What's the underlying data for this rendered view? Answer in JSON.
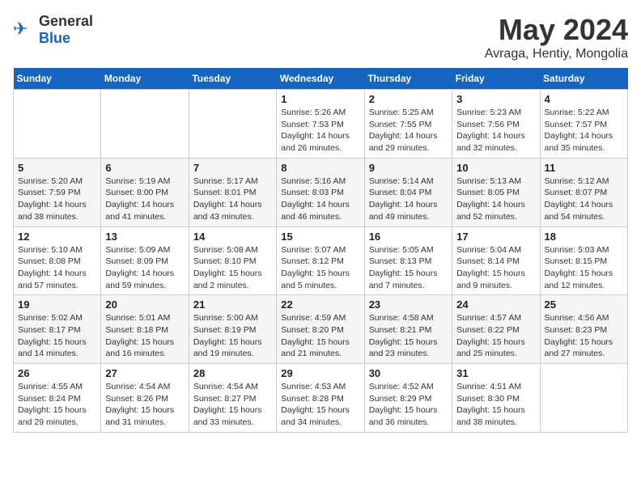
{
  "logo": {
    "general": "General",
    "blue": "Blue"
  },
  "title": "May 2024",
  "location": "Avraga, Hentiy, Mongolia",
  "days_of_week": [
    "Sunday",
    "Monday",
    "Tuesday",
    "Wednesday",
    "Thursday",
    "Friday",
    "Saturday"
  ],
  "weeks": [
    [
      {
        "day": "",
        "sunrise": "",
        "sunset": "",
        "daylight": ""
      },
      {
        "day": "",
        "sunrise": "",
        "sunset": "",
        "daylight": ""
      },
      {
        "day": "",
        "sunrise": "",
        "sunset": "",
        "daylight": ""
      },
      {
        "day": "1",
        "sunrise": "Sunrise: 5:26 AM",
        "sunset": "Sunset: 7:53 PM",
        "daylight": "Daylight: 14 hours and 26 minutes."
      },
      {
        "day": "2",
        "sunrise": "Sunrise: 5:25 AM",
        "sunset": "Sunset: 7:55 PM",
        "daylight": "Daylight: 14 hours and 29 minutes."
      },
      {
        "day": "3",
        "sunrise": "Sunrise: 5:23 AM",
        "sunset": "Sunset: 7:56 PM",
        "daylight": "Daylight: 14 hours and 32 minutes."
      },
      {
        "day": "4",
        "sunrise": "Sunrise: 5:22 AM",
        "sunset": "Sunset: 7:57 PM",
        "daylight": "Daylight: 14 hours and 35 minutes."
      }
    ],
    [
      {
        "day": "5",
        "sunrise": "Sunrise: 5:20 AM",
        "sunset": "Sunset: 7:59 PM",
        "daylight": "Daylight: 14 hours and 38 minutes."
      },
      {
        "day": "6",
        "sunrise": "Sunrise: 5:19 AM",
        "sunset": "Sunset: 8:00 PM",
        "daylight": "Daylight: 14 hours and 41 minutes."
      },
      {
        "day": "7",
        "sunrise": "Sunrise: 5:17 AM",
        "sunset": "Sunset: 8:01 PM",
        "daylight": "Daylight: 14 hours and 43 minutes."
      },
      {
        "day": "8",
        "sunrise": "Sunrise: 5:16 AM",
        "sunset": "Sunset: 8:03 PM",
        "daylight": "Daylight: 14 hours and 46 minutes."
      },
      {
        "day": "9",
        "sunrise": "Sunrise: 5:14 AM",
        "sunset": "Sunset: 8:04 PM",
        "daylight": "Daylight: 14 hours and 49 minutes."
      },
      {
        "day": "10",
        "sunrise": "Sunrise: 5:13 AM",
        "sunset": "Sunset: 8:05 PM",
        "daylight": "Daylight: 14 hours and 52 minutes."
      },
      {
        "day": "11",
        "sunrise": "Sunrise: 5:12 AM",
        "sunset": "Sunset: 8:07 PM",
        "daylight": "Daylight: 14 hours and 54 minutes."
      }
    ],
    [
      {
        "day": "12",
        "sunrise": "Sunrise: 5:10 AM",
        "sunset": "Sunset: 8:08 PM",
        "daylight": "Daylight: 14 hours and 57 minutes."
      },
      {
        "day": "13",
        "sunrise": "Sunrise: 5:09 AM",
        "sunset": "Sunset: 8:09 PM",
        "daylight": "Daylight: 14 hours and 59 minutes."
      },
      {
        "day": "14",
        "sunrise": "Sunrise: 5:08 AM",
        "sunset": "Sunset: 8:10 PM",
        "daylight": "Daylight: 15 hours and 2 minutes."
      },
      {
        "day": "15",
        "sunrise": "Sunrise: 5:07 AM",
        "sunset": "Sunset: 8:12 PM",
        "daylight": "Daylight: 15 hours and 5 minutes."
      },
      {
        "day": "16",
        "sunrise": "Sunrise: 5:05 AM",
        "sunset": "Sunset: 8:13 PM",
        "daylight": "Daylight: 15 hours and 7 minutes."
      },
      {
        "day": "17",
        "sunrise": "Sunrise: 5:04 AM",
        "sunset": "Sunset: 8:14 PM",
        "daylight": "Daylight: 15 hours and 9 minutes."
      },
      {
        "day": "18",
        "sunrise": "Sunrise: 5:03 AM",
        "sunset": "Sunset: 8:15 PM",
        "daylight": "Daylight: 15 hours and 12 minutes."
      }
    ],
    [
      {
        "day": "19",
        "sunrise": "Sunrise: 5:02 AM",
        "sunset": "Sunset: 8:17 PM",
        "daylight": "Daylight: 15 hours and 14 minutes."
      },
      {
        "day": "20",
        "sunrise": "Sunrise: 5:01 AM",
        "sunset": "Sunset: 8:18 PM",
        "daylight": "Daylight: 15 hours and 16 minutes."
      },
      {
        "day": "21",
        "sunrise": "Sunrise: 5:00 AM",
        "sunset": "Sunset: 8:19 PM",
        "daylight": "Daylight: 15 hours and 19 minutes."
      },
      {
        "day": "22",
        "sunrise": "Sunrise: 4:59 AM",
        "sunset": "Sunset: 8:20 PM",
        "daylight": "Daylight: 15 hours and 21 minutes."
      },
      {
        "day": "23",
        "sunrise": "Sunrise: 4:58 AM",
        "sunset": "Sunset: 8:21 PM",
        "daylight": "Daylight: 15 hours and 23 minutes."
      },
      {
        "day": "24",
        "sunrise": "Sunrise: 4:57 AM",
        "sunset": "Sunset: 8:22 PM",
        "daylight": "Daylight: 15 hours and 25 minutes."
      },
      {
        "day": "25",
        "sunrise": "Sunrise: 4:56 AM",
        "sunset": "Sunset: 8:23 PM",
        "daylight": "Daylight: 15 hours and 27 minutes."
      }
    ],
    [
      {
        "day": "26",
        "sunrise": "Sunrise: 4:55 AM",
        "sunset": "Sunset: 8:24 PM",
        "daylight": "Daylight: 15 hours and 29 minutes."
      },
      {
        "day": "27",
        "sunrise": "Sunrise: 4:54 AM",
        "sunset": "Sunset: 8:26 PM",
        "daylight": "Daylight: 15 hours and 31 minutes."
      },
      {
        "day": "28",
        "sunrise": "Sunrise: 4:54 AM",
        "sunset": "Sunset: 8:27 PM",
        "daylight": "Daylight: 15 hours and 33 minutes."
      },
      {
        "day": "29",
        "sunrise": "Sunrise: 4:53 AM",
        "sunset": "Sunset: 8:28 PM",
        "daylight": "Daylight: 15 hours and 34 minutes."
      },
      {
        "day": "30",
        "sunrise": "Sunrise: 4:52 AM",
        "sunset": "Sunset: 8:29 PM",
        "daylight": "Daylight: 15 hours and 36 minutes."
      },
      {
        "day": "31",
        "sunrise": "Sunrise: 4:51 AM",
        "sunset": "Sunset: 8:30 PM",
        "daylight": "Daylight: 15 hours and 38 minutes."
      },
      {
        "day": "",
        "sunrise": "",
        "sunset": "",
        "daylight": ""
      }
    ]
  ]
}
